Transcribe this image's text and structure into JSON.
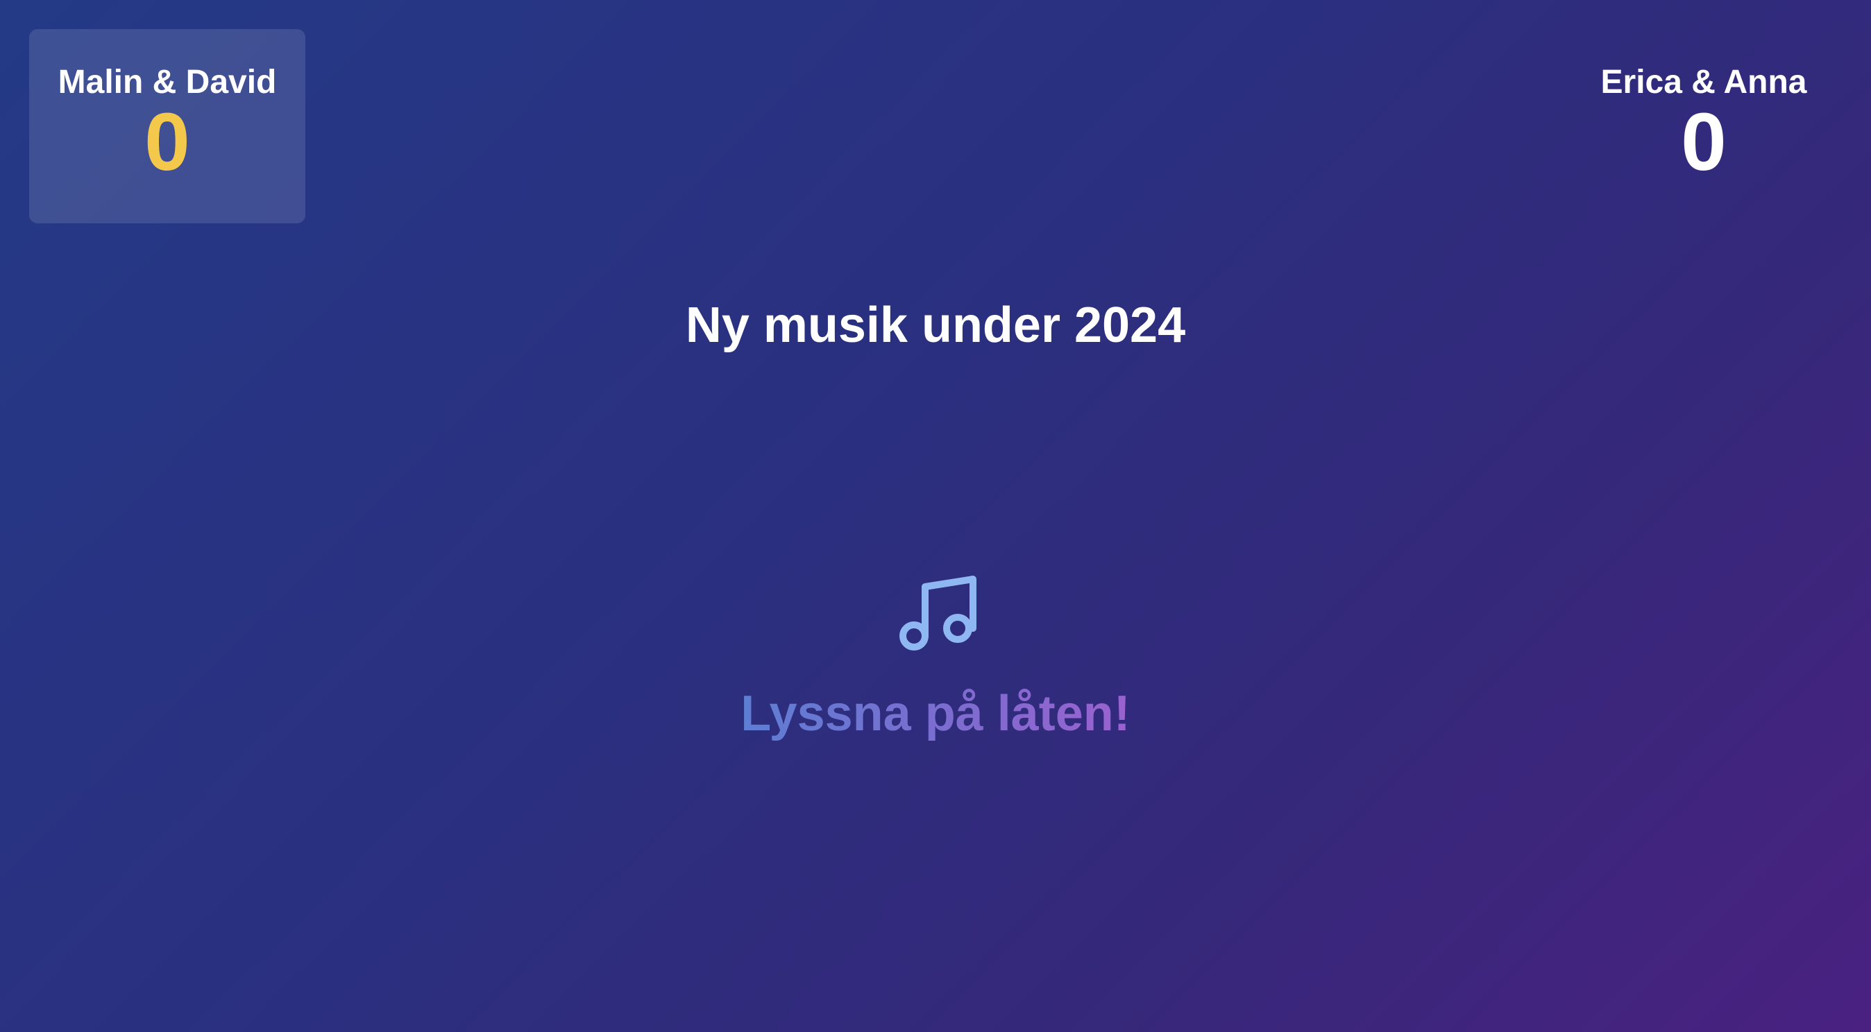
{
  "teams": [
    {
      "name": "Malin & David",
      "score": "0",
      "active": true,
      "score_color": "#f4c84a"
    },
    {
      "name": "Erica & Anna",
      "score": "0",
      "active": false,
      "score_color": "#ffffff"
    }
  ],
  "round": {
    "title": "Ny musik under 2024"
  },
  "playback": {
    "icon": "music-note-icon",
    "prompt": "Lyssna på låten!"
  },
  "colors": {
    "background_start": "#243a87",
    "background_end": "#4a2180",
    "active_score": "#f4c84a",
    "icon": "#8fb8f2",
    "prompt_start": "#5d7ed4",
    "prompt_end": "#9a62cf"
  }
}
